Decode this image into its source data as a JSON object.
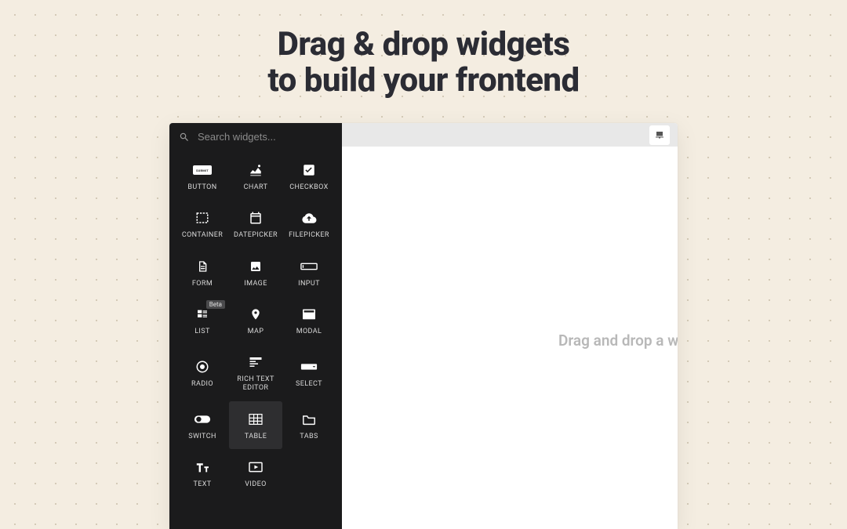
{
  "headline": {
    "line1": "Drag & drop widgets",
    "line2": "to build your frontend"
  },
  "search": {
    "placeholder": "Search widgets..."
  },
  "widgets": {
    "button": {
      "label": "BUTTON",
      "pill_text": "SUBMIT"
    },
    "chart": {
      "label": "CHART"
    },
    "checkbox": {
      "label": "CHECKBOX"
    },
    "container": {
      "label": "CONTAINER"
    },
    "datepicker": {
      "label": "DATEPICKER"
    },
    "filepicker": {
      "label": "FILEPICKER"
    },
    "form": {
      "label": "FORM"
    },
    "image": {
      "label": "IMAGE"
    },
    "input": {
      "label": "INPUT"
    },
    "list": {
      "label": "LIST",
      "badge": "Beta"
    },
    "map": {
      "label": "MAP"
    },
    "modal": {
      "label": "MODAL"
    },
    "radio": {
      "label": "RADIO"
    },
    "richtext": {
      "label": "RICH TEXT",
      "label2": "EDITOR"
    },
    "select": {
      "label": "SELECT"
    },
    "switch": {
      "label": "SWITCH"
    },
    "table": {
      "label": "TABLE",
      "selected": true
    },
    "tabs": {
      "label": "TABS"
    },
    "text": {
      "label": "TEXT"
    },
    "video": {
      "label": "VIDEO"
    }
  },
  "canvas": {
    "drop_hint": "Drag and drop a w"
  }
}
